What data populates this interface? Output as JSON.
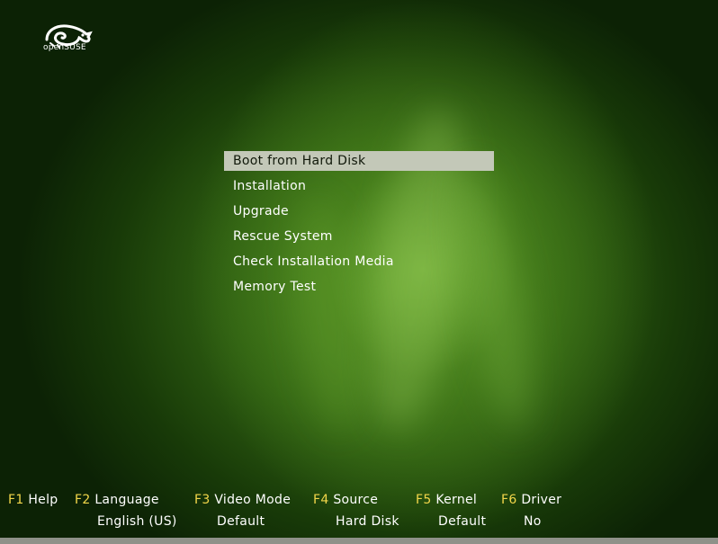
{
  "logo": {
    "text": "openSUSE"
  },
  "menu": {
    "items": [
      {
        "label": "Boot from Hard Disk",
        "selected": true
      },
      {
        "label": "Installation"
      },
      {
        "label": "Upgrade"
      },
      {
        "label": "Rescue System"
      },
      {
        "label": "Check Installation Media"
      },
      {
        "label": "Memory Test"
      }
    ]
  },
  "fkeys": [
    {
      "key": "F1",
      "label": "Help",
      "value": ""
    },
    {
      "key": "F2",
      "label": "Language",
      "value": "English (US)"
    },
    {
      "key": "F3",
      "label": "Video Mode",
      "value": "Default"
    },
    {
      "key": "F4",
      "label": "Source",
      "value": "Hard Disk"
    },
    {
      "key": "F5",
      "label": "Kernel",
      "value": "Default"
    },
    {
      "key": "F6",
      "label": "Driver",
      "value": "No"
    }
  ],
  "colors": {
    "key_yellow": "#f2d64a",
    "selection_bg": "#c3c8b8",
    "text": "#ffffff"
  }
}
